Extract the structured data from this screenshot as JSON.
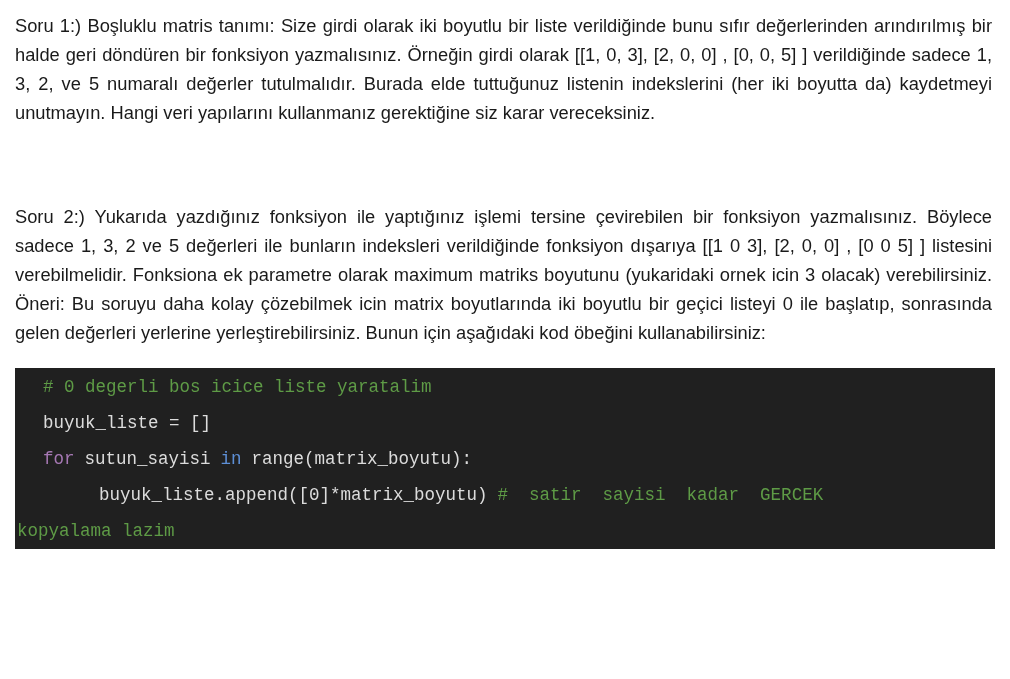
{
  "paragraphs": [
    "Soru 1:) Boşluklu matris tanımı: Size girdi olarak iki boyutlu bir liste verildiğinde bunu sıfır değerlerinden arındırılmış bir halde geri döndüren bir fonksiyon yazmalısınız. Örneğin girdi olarak [[1, 0, 3], [2, 0, 0] , [0, 0, 5] ] verildiğinde sadece 1, 3, 2, ve 5 numaralı değerler tutulmalıdır. Burada elde tuttuğunuz listenin indekslerini (her iki boyutta da) kaydetmeyi unutmayın. Hangi veri yapılarını kullanmanız gerektiğine siz karar vereceksiniz.",
    "Soru 2:) Yukarıda yazdığınız fonksiyon ile yaptığınız işlemi tersine çevirebilen bir fonksiyon yazmalısınız. Böylece sadece 1, 3, 2 ve 5 değerleri ile bunların indeksleri verildiğinde fonksiyon dışarıya  [[1 0 3], [2, 0, 0] , [0 0 5] ] listesini verebilmelidir. Fonksiona ek parametre olarak maximum matriks boyutunu (yukaridaki ornek icin 3 olacak) verebilirsiniz. Öneri: Bu soruyu daha kolay çözebilmek icin matrix boyutlarında iki boyutlu bir geçici listeyi 0 ile başlatıp, sonrasında gelen değerleri yerlerine yerleştirebilirsiniz. Bunun için aşağıdaki kod öbeğini kullanabilirsiniz:"
  ],
  "code_lines": [
    {
      "kind": "top",
      "tokens": [
        {
          "kind": "comment",
          "text": "# 0 degerli bos icice liste yaratalim"
        }
      ]
    },
    {
      "kind": "top",
      "tokens": [
        {
          "kind": "plain",
          "text": "buyuk_liste = []"
        }
      ]
    },
    {
      "kind": "top",
      "tokens": [
        {
          "kind": "keyword",
          "text": "for"
        },
        {
          "kind": "plain",
          "text": "sutun_sayisi"
        },
        {
          "kind": "operator",
          "text": "in"
        },
        {
          "kind": "plain",
          "text": "range(matrix_boyutu):"
        }
      ]
    },
    {
      "kind": "block",
      "tokens": [
        {
          "kind": "plain",
          "text": "buyuk_liste.append([0]*matrix_boyutu)"
        },
        {
          "kind": "comment",
          "text": "#  satir  sayisi  kadar  GERCEK"
        }
      ]
    },
    {
      "kind": "wrap",
      "tokens": [
        {
          "kind": "comment",
          "text": "kopyalama lazim"
        }
      ]
    }
  ]
}
